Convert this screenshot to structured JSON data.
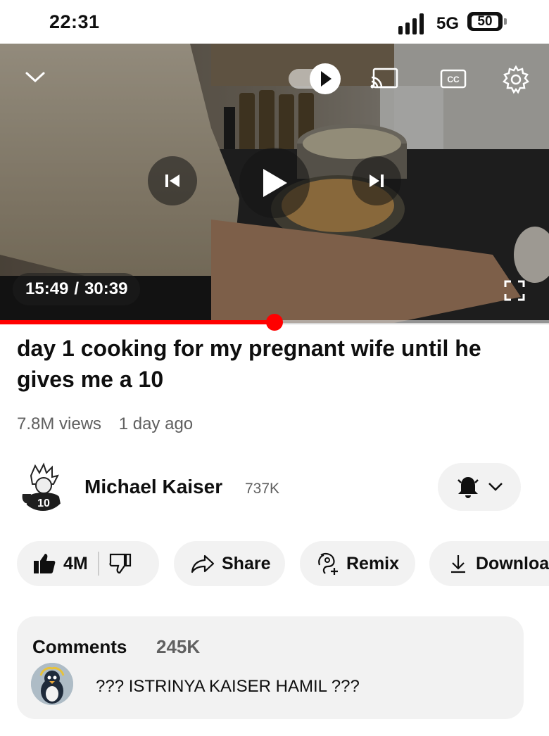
{
  "status": {
    "time": "22:31",
    "network": "5G",
    "battery": "50"
  },
  "player": {
    "current_time": "15:49",
    "separator": "/",
    "duration": "30:39",
    "progress_fraction": 0.5,
    "autoplay_on": true
  },
  "video": {
    "title": "day 1 cooking for my pregnant wife until he gives me a 10",
    "views": "7.8M views",
    "age": "1 day ago"
  },
  "channel": {
    "name": "Michael Kaiser",
    "subscribers": "737K",
    "avatar_jersey": "10"
  },
  "actions": {
    "likes": "4M",
    "share": "Share",
    "remix": "Remix",
    "download": "Download"
  },
  "comments": {
    "label": "Comments",
    "count": "245K",
    "top_comment": "??? ISTRINYA KAISER HAMIL ???"
  },
  "colors": {
    "accent": "#ff0000",
    "chip_bg": "#f2f2f2",
    "secondary_text": "#606060"
  }
}
